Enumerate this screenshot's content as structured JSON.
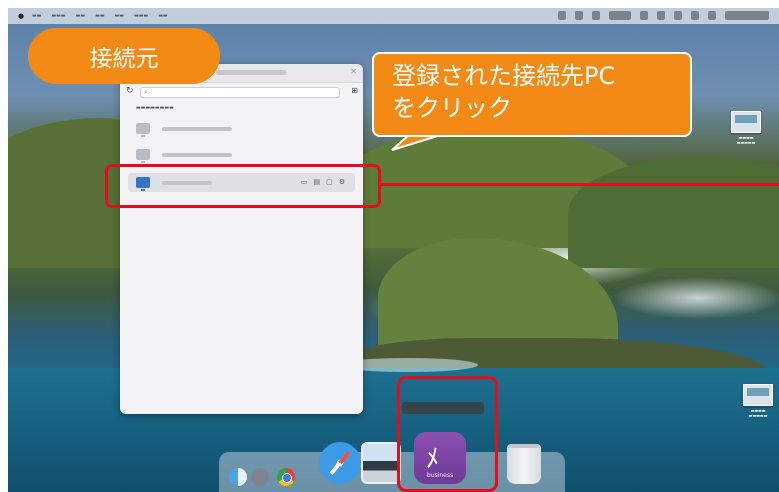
{
  "annotations": {
    "source_badge": "接続元",
    "callout_line1": "登録された接続先PC",
    "callout_line2": "をクリック"
  },
  "dock": {
    "splashtop_label": "business"
  },
  "colors": {
    "annotation_orange": "#f48a16",
    "highlight_red": "#e40d1b",
    "splashtop_purple": "#7a43a3",
    "selected_monitor_blue": "#3a72c8"
  },
  "icons": [
    "apple-icon",
    "refresh-icon",
    "search-icon",
    "add-icon",
    "monitor-icon",
    "finder-icon",
    "launchpad-icon",
    "chrome-icon",
    "safari-icon",
    "preview-icon",
    "splashtop-icon",
    "trash-icon"
  ]
}
